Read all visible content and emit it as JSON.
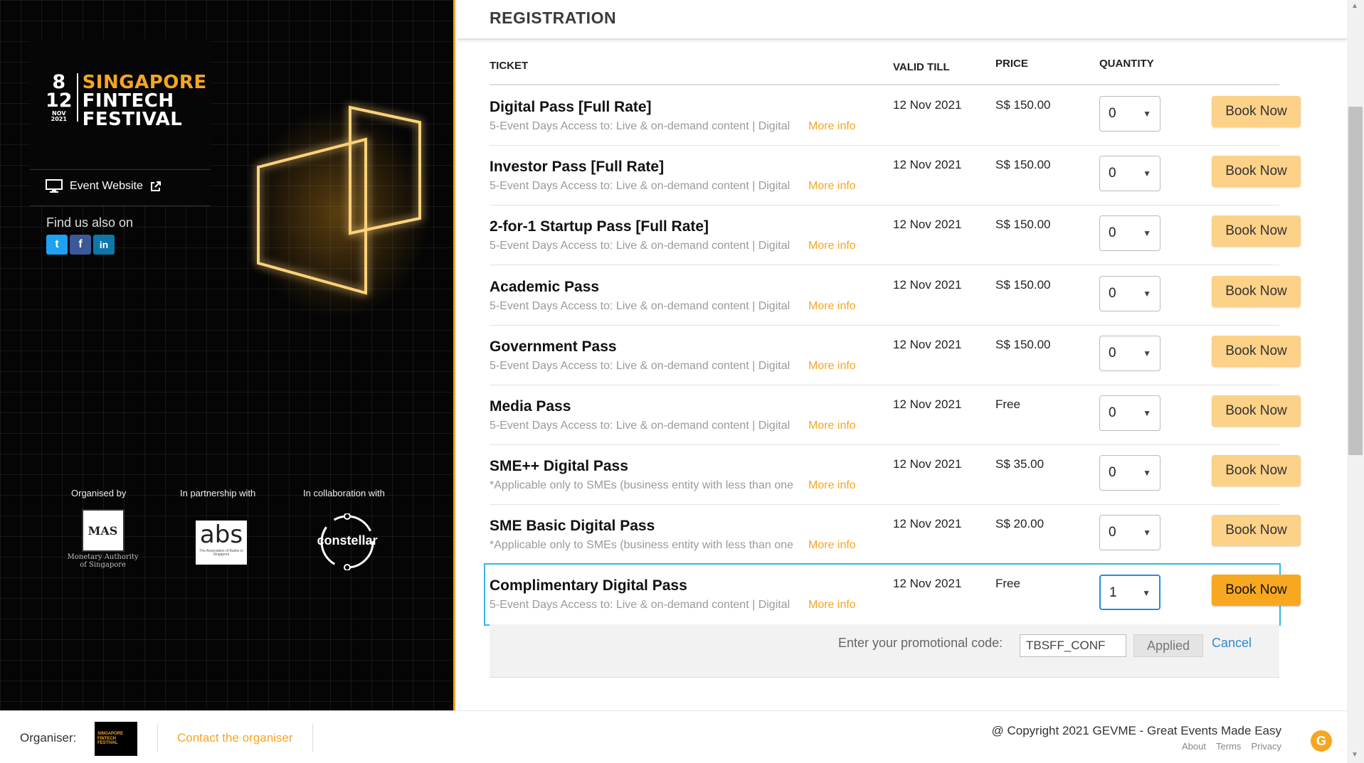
{
  "sidebar": {
    "logo": {
      "day_start": "8",
      "day_end": "12",
      "month": "NOV",
      "year": "2021",
      "name_line1": "SINGAPORE",
      "name_line2": "FINTECH",
      "name_line3": "FESTIVAL"
    },
    "event_website_label": "Event Website",
    "find_us_label": "Find us also on",
    "socials": [
      {
        "name": "twitter",
        "glyph": "t"
      },
      {
        "name": "facebook",
        "glyph": "f"
      },
      {
        "name": "linkedin",
        "glyph": "in"
      }
    ],
    "partners": {
      "organised_by": "Organised by",
      "in_partnership": "In partnership with",
      "in_collaboration": "In collaboration with",
      "mas_logo_text": "MAS",
      "mas_caption": "Monetary Authority of Singapore",
      "abs_logo_text": "abs",
      "abs_caption": "The Association of Banks in Singapore",
      "constellar_logo_text": "constellar"
    }
  },
  "registration": {
    "title": "REGISTRATION",
    "columns": {
      "ticket": "TICKET",
      "valid_till": "VALID TILL",
      "price": "PRICE",
      "quantity": "QUANTITY"
    },
    "tickets": [
      {
        "name": "Digital Pass [Full Rate]",
        "desc": "5-Event Days Access to: Live & on-demand content | Digital",
        "more": "More info",
        "valid": "12 Nov 2021",
        "price": "S$ 150.00",
        "qty": "0",
        "book": "Book Now"
      },
      {
        "name": "Investor Pass [Full Rate]",
        "desc": "5-Event Days Access to: Live & on-demand content | Digital",
        "more": "More info",
        "valid": "12 Nov 2021",
        "price": "S$ 150.00",
        "qty": "0",
        "book": "Book Now"
      },
      {
        "name": "2-for-1 Startup Pass [Full Rate]",
        "desc": "5-Event Days Access to: Live & on-demand content | Digital",
        "more": "More info",
        "valid": "12 Nov 2021",
        "price": "S$ 150.00",
        "qty": "0",
        "book": "Book Now"
      },
      {
        "name": "Academic Pass",
        "desc": "5-Event Days Access to: Live & on-demand content | Digital",
        "more": "More info",
        "valid": "12 Nov 2021",
        "price": "S$ 150.00",
        "qty": "0",
        "book": "Book Now"
      },
      {
        "name": "Government Pass",
        "desc": "5-Event Days Access to: Live & on-demand content | Digital",
        "more": "More info",
        "valid": "12 Nov 2021",
        "price": "S$ 150.00",
        "qty": "0",
        "book": "Book Now"
      },
      {
        "name": "Media Pass",
        "desc": "5-Event Days Access to: Live & on-demand content | Digital",
        "more": "More info",
        "valid": "12 Nov 2021",
        "price": "Free",
        "qty": "0",
        "book": "Book Now"
      },
      {
        "name": "SME++ Digital Pass",
        "desc": "*Applicable only to SMEs (business entity with less than one",
        "more": "More info",
        "valid": "12 Nov 2021",
        "price": "S$ 35.00",
        "qty": "0",
        "book": "Book Now"
      },
      {
        "name": "SME Basic Digital Pass",
        "desc": "*Applicable only to SMEs (business entity with less than one",
        "more": "More info",
        "valid": "12 Nov 2021",
        "price": "S$ 20.00",
        "qty": "0",
        "book": "Book Now"
      },
      {
        "name": "Complimentary Digital Pass",
        "desc": "5-Event Days Access to: Live & on-demand content | Digital",
        "more": "More info",
        "valid": "12 Nov 2021",
        "price": "Free",
        "qty": "1",
        "book": "Book Now"
      }
    ],
    "promo": {
      "label": "Enter your promotional code:",
      "code": "TBSFF_CONF",
      "applied": "Applied",
      "cancel": "Cancel"
    }
  },
  "footer": {
    "organiser_label": "Organiser:",
    "organiser_logo_text": "SINGAPORE FINTECH FESTIVAL",
    "contact": "Contact the organiser",
    "copyright": "@ Copyright 2021 GEVME - Great Events Made Easy",
    "links": [
      "About",
      "Terms",
      "Privacy"
    ],
    "brand_glyph": "G"
  },
  "colors": {
    "accent": "#f5a623",
    "selected_border": "#35b8e0",
    "link_blue": "#2a8bd6"
  }
}
